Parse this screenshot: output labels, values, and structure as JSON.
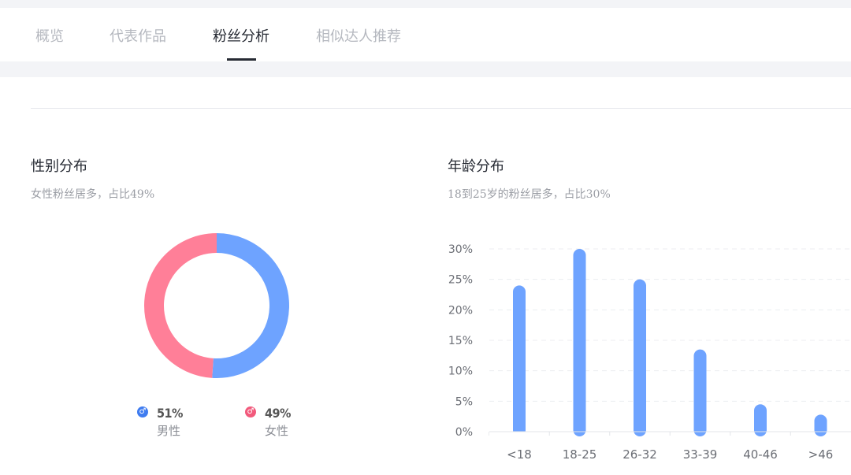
{
  "tabs": [
    {
      "label": "概览",
      "active": false
    },
    {
      "label": "代表作品",
      "active": false
    },
    {
      "label": "粉丝分析",
      "active": true
    },
    {
      "label": "相似达人推荐",
      "active": false
    }
  ],
  "gender": {
    "title": "性别分布",
    "subtitle": "女性粉丝居多，占比49%",
    "male": {
      "value": "51%",
      "label": "男性",
      "percent": 51,
      "color": "#6ea3ff",
      "icon": "male-icon"
    },
    "female": {
      "value": "49%",
      "label": "女性",
      "percent": 49,
      "color": "#ff7f98",
      "icon": "female-icon"
    }
  },
  "age": {
    "title": "年龄分布",
    "subtitle": "18到25岁的粉丝居多，占比30%"
  },
  "chart_data": {
    "type": "bar",
    "categories": [
      "<18",
      "18-25",
      "26-32",
      "33-39",
      "40-46",
      ">46"
    ],
    "values": [
      24,
      30,
      25,
      13.5,
      4.5,
      2.8
    ],
    "ylim": [
      0,
      30
    ],
    "yticks": [
      "0%",
      "5%",
      "10%",
      "15%",
      "20%",
      "25%",
      "30%"
    ],
    "ytick_values": [
      0,
      5,
      10,
      15,
      20,
      25,
      30
    ],
    "bar_color": "#6ea3ff",
    "grid": true
  }
}
